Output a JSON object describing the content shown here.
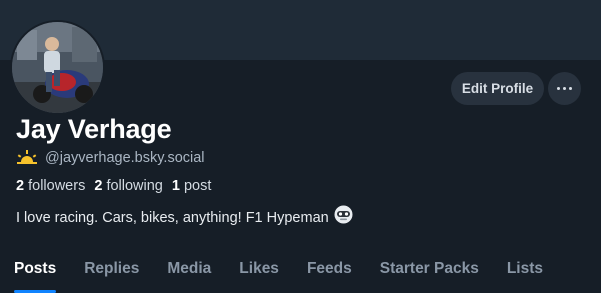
{
  "profile": {
    "display_name": "Jay Verhage",
    "handle": "@jayverhage.bsky.social",
    "handle_icon": "sunrise-icon",
    "bio": "I love racing. Cars, bikes, anything! F1 Hypeman",
    "bio_icon": "robot-face-icon"
  },
  "stats": {
    "followers_count": "2",
    "followers_label": "followers",
    "following_count": "2",
    "following_label": "following",
    "posts_count": "1",
    "posts_label": "post"
  },
  "actions": {
    "edit_label": "Edit Profile",
    "more_icon": "more-horizontal-icon"
  },
  "tabs": [
    {
      "label": "Posts",
      "active": true
    },
    {
      "label": "Replies"
    },
    {
      "label": "Media"
    },
    {
      "label": "Likes"
    },
    {
      "label": "Feeds"
    },
    {
      "label": "Starter Packs"
    },
    {
      "label": "Lists"
    }
  ],
  "colors": {
    "background": "#161e27",
    "banner": "#1f2b37",
    "accent": "#1083fe",
    "button_bg": "#28323e"
  }
}
